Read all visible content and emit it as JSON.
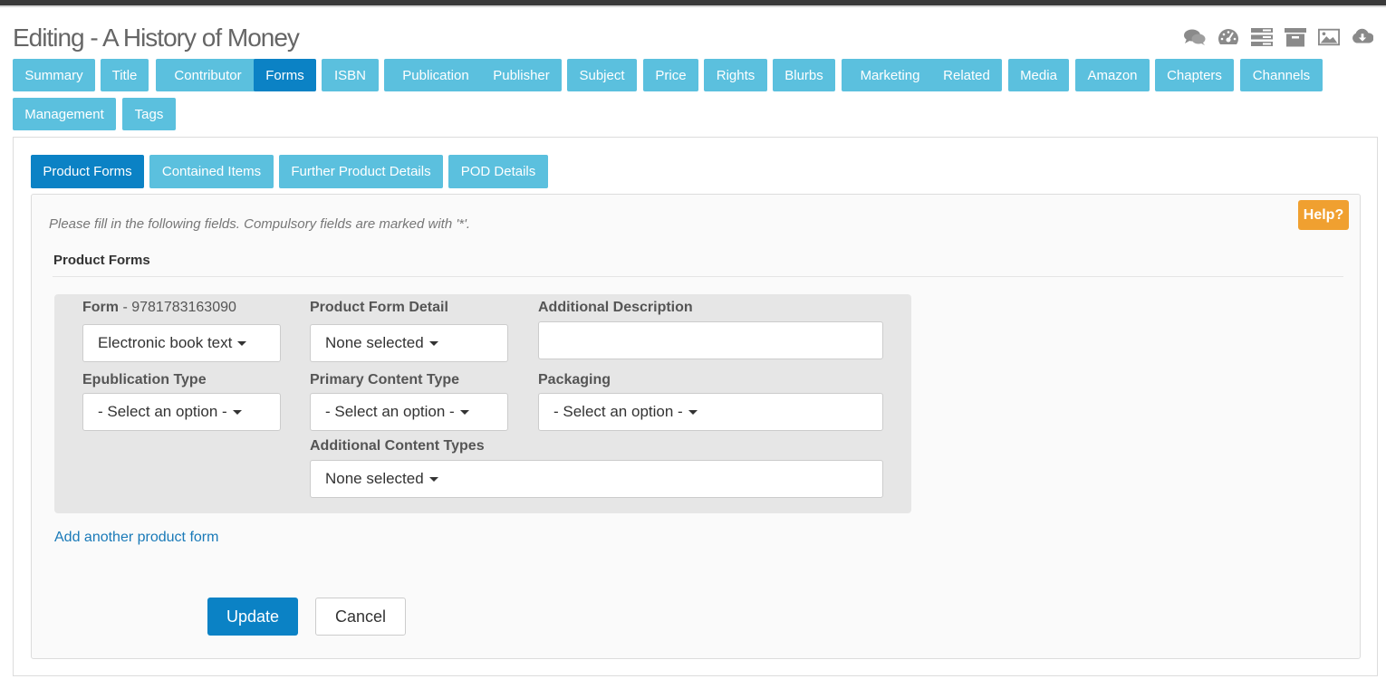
{
  "page": {
    "title": "Editing - A History of Money"
  },
  "toolbar": {
    "icons": [
      "comments-icon",
      "dashboard-icon",
      "list-icon",
      "archive-icon",
      "image-icon",
      "cloud-download-icon"
    ]
  },
  "main_tabs": {
    "items": [
      {
        "label": "Summary"
      },
      {
        "label": "Title"
      },
      {
        "label": "Contributor"
      },
      {
        "label": "Forms"
      },
      {
        "label": "ISBN"
      },
      {
        "label": "Publication"
      },
      {
        "label": "Publisher"
      },
      {
        "label": "Subject"
      },
      {
        "label": "Price"
      },
      {
        "label": "Rights"
      },
      {
        "label": "Blurbs"
      },
      {
        "label": "Marketing"
      },
      {
        "label": "Related"
      },
      {
        "label": "Media"
      },
      {
        "label": "Amazon"
      },
      {
        "label": "Chapters"
      },
      {
        "label": "Channels"
      },
      {
        "label": "Management"
      },
      {
        "label": "Tags"
      }
    ],
    "active": "Forms"
  },
  "sub_tabs": {
    "items": [
      {
        "label": "Product Forms"
      },
      {
        "label": "Contained Items"
      },
      {
        "label": "Further Product Details"
      },
      {
        "label": "POD Details"
      }
    ],
    "active": "Product Forms"
  },
  "help": {
    "label": "Help?"
  },
  "instructions": "Please fill in the following fields. Compulsory fields are marked with '*'.",
  "section_title": "Product Forms",
  "form": {
    "form_label": "Form",
    "form_isbn": " - 9781783163090",
    "form_value": "Electronic book text",
    "product_form_detail_label": "Product Form Detail",
    "product_form_detail_value": "None selected",
    "additional_description_label": "Additional Description",
    "additional_description_value": "",
    "epublication_type_label": "Epublication Type",
    "epublication_type_value": "- Select an option -",
    "primary_content_type_label": "Primary Content Type",
    "primary_content_type_value": "- Select an option -",
    "packaging_label": "Packaging",
    "packaging_value": "- Select an option -",
    "additional_content_types_label": "Additional Content Types",
    "additional_content_types_value": "None selected"
  },
  "add_link": "Add another product form",
  "buttons": {
    "update": "Update",
    "cancel": "Cancel"
  },
  "colors": {
    "tab": "#5bc0de",
    "tab_active": "#0b82c5",
    "help": "#f0a030",
    "link": "#1a7ab8"
  }
}
